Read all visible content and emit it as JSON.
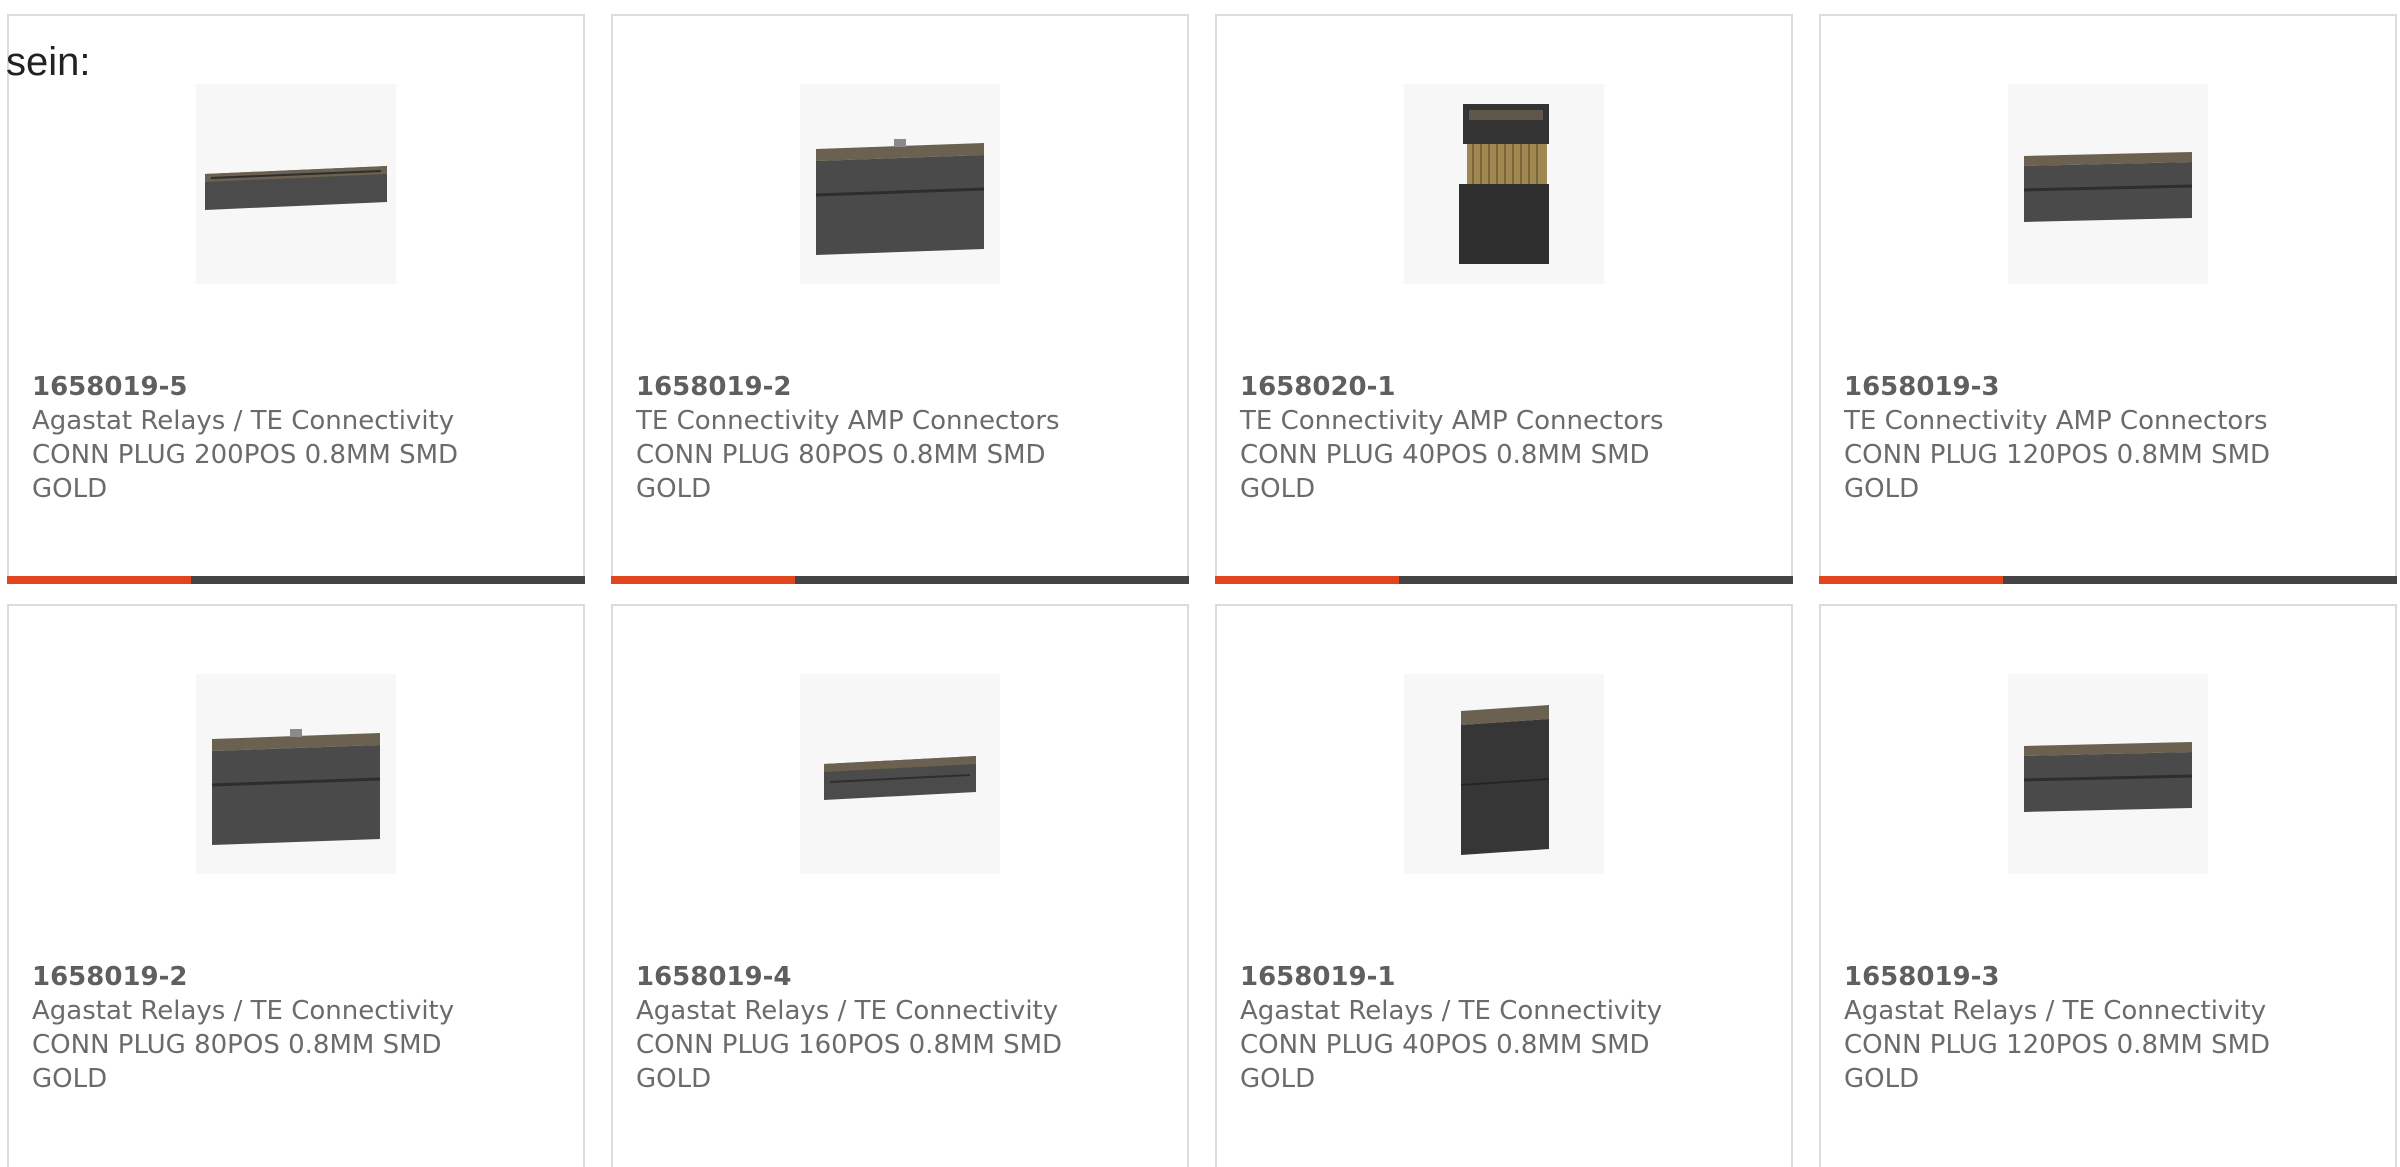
{
  "intro_text": "sein:",
  "colors": {
    "accent": "#e2451d",
    "bar_dark": "#444444",
    "text": "#6b6b6b",
    "border": "#dcdcdc"
  },
  "products": [
    {
      "part_number": "1658019-5",
      "manufacturer": "Agastat Relays / TE Connectivity",
      "description_line1": "CONN PLUG 200POS 0.8MM SMD",
      "description_line2": "GOLD",
      "image": "long-low-connector"
    },
    {
      "part_number": "1658019-2",
      "manufacturer": "TE Connectivity AMP Connectors",
      "description_line1": "CONN PLUG 80POS 0.8MM SMD",
      "description_line2": "GOLD",
      "image": "wide-tall-connector"
    },
    {
      "part_number": "1658020-1",
      "manufacturer": "TE Connectivity AMP Connectors",
      "description_line1": "CONN PLUG 40POS 0.8MM SMD",
      "description_line2": "GOLD",
      "image": "narrow-connector-with-pins"
    },
    {
      "part_number": "1658019-3",
      "manufacturer": "TE Connectivity AMP Connectors",
      "description_line1": "CONN PLUG 120POS 0.8MM SMD",
      "description_line2": "GOLD",
      "image": "medium-connector"
    },
    {
      "part_number": "1658019-2",
      "manufacturer": "Agastat Relays / TE Connectivity",
      "description_line1": "CONN PLUG 80POS 0.8MM SMD",
      "description_line2": "GOLD",
      "image": "wide-tall-connector"
    },
    {
      "part_number": "1658019-4",
      "manufacturer": "Agastat Relays / TE Connectivity",
      "description_line1": "CONN PLUG 160POS 0.8MM SMD",
      "description_line2": "GOLD",
      "image": "long-low-connector"
    },
    {
      "part_number": "1658019-1",
      "manufacturer": "Agastat Relays / TE Connectivity",
      "description_line1": "CONN PLUG 40POS 0.8MM SMD",
      "description_line2": "GOLD",
      "image": "narrow-connector"
    },
    {
      "part_number": "1658019-3",
      "manufacturer": "Agastat Relays / TE Connectivity",
      "description_line1": "CONN PLUG 120POS 0.8MM SMD",
      "description_line2": "GOLD",
      "image": "medium-connector"
    }
  ]
}
